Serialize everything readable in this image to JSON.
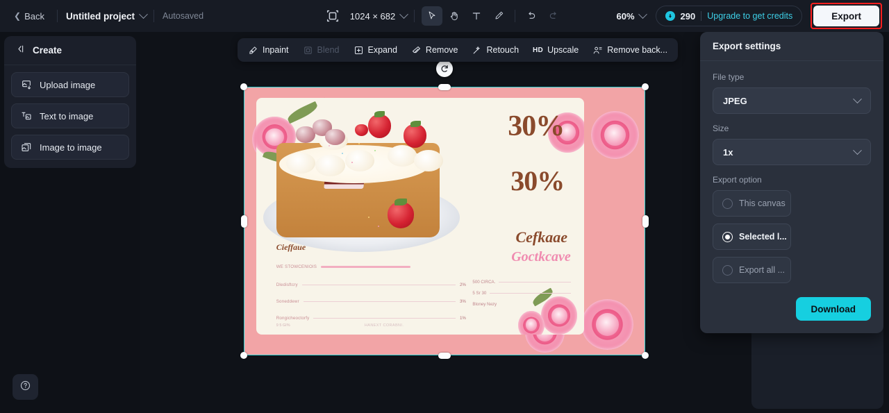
{
  "topbar": {
    "back_label": "Back",
    "project_name": "Untitled project",
    "autosaved_label": "Autosaved",
    "canvas_dimensions": "1024 × 682",
    "crop_icon": "crop-frame-icon",
    "tools": [
      {
        "name": "select-tool",
        "icon": "cursor-arrow-icon",
        "active": true
      },
      {
        "name": "hand-tool",
        "icon": "hand-icon",
        "active": false
      },
      {
        "name": "text-tool",
        "icon": "text-t-icon",
        "active": false
      },
      {
        "name": "brush-tool",
        "icon": "brush-icon",
        "active": false
      },
      {
        "name": "undo-tool",
        "icon": "undo-arrow-icon",
        "active": false
      },
      {
        "name": "redo-tool",
        "icon": "redo-arrow-icon",
        "active": false
      }
    ],
    "zoom_level": "60%",
    "credits_count": "290",
    "credits_icon": "credit-coin-icon",
    "upgrade_label": "Upgrade to get credits",
    "export_label": "Export",
    "highlight_color": "#ff1f1f",
    "accent_color": "#3ed0e8"
  },
  "sidebar": {
    "header_title": "Create",
    "header_icon": "collapse-panel-icon",
    "items": [
      {
        "label": "Upload image",
        "icon": "upload-image-icon"
      },
      {
        "label": "Text to image",
        "icon": "text-to-image-icon"
      },
      {
        "label": "Image to image",
        "icon": "image-to-image-icon"
      }
    ],
    "help_icon": "question-mark-icon"
  },
  "float_toolbar": {
    "items": [
      {
        "label": "Inpaint",
        "icon": "inpaint-brush-icon",
        "disabled": false
      },
      {
        "label": "Blend",
        "icon": "blend-icon",
        "disabled": true
      },
      {
        "label": "Expand",
        "icon": "expand-frame-icon",
        "disabled": false
      },
      {
        "label": "Remove",
        "icon": "eraser-icon",
        "disabled": false
      },
      {
        "label": "Retouch",
        "icon": "retouch-wand-icon",
        "disabled": false
      },
      {
        "label": "Upscale",
        "icon": "hd-upscale-icon",
        "badge": "HD",
        "disabled": false
      },
      {
        "label": "Remove back...",
        "icon": "remove-background-icon",
        "disabled": false
      }
    ]
  },
  "canvas": {
    "selection_color": "#2fd4d4",
    "rotate_icon": "rotate-handle-icon",
    "poster": {
      "background_color": "#f2a4a6",
      "card_color": "#f8f4e9",
      "discount_large": "30%",
      "discount_small": "30%",
      "script_title": "Cefkaae",
      "script_subtitle": "Goctkcave",
      "menu_heading": "Cieffaue",
      "menu_rows": [
        {
          "label": "WE STOWCENIOIS",
          "price": ""
        },
        {
          "label": "Dledisftcry",
          "price": "2%"
        },
        {
          "label": "Soneddewr",
          "price": "3%"
        },
        {
          "label": "Rongicheoctorfy",
          "price": "1%"
        }
      ],
      "right_rows": [
        {
          "text": "500 CIRCA."
        },
        {
          "text": "5 Sr 30"
        },
        {
          "text": "Bloney Nezy"
        }
      ],
      "footnote": "9 5 GI%",
      "footnote2": "HANEXT CORABNI."
    }
  },
  "export_panel": {
    "title": "Export settings",
    "file_type_label": "File type",
    "file_type_value": "JPEG",
    "size_label": "Size",
    "size_value": "1x",
    "export_option_label": "Export option",
    "options": [
      {
        "label": "This canvas",
        "selected": false
      },
      {
        "label": "Selected l...",
        "selected": true
      },
      {
        "label": "Export all ...",
        "selected": false
      }
    ],
    "download_label": "Download",
    "download_color": "#16cfe0"
  }
}
